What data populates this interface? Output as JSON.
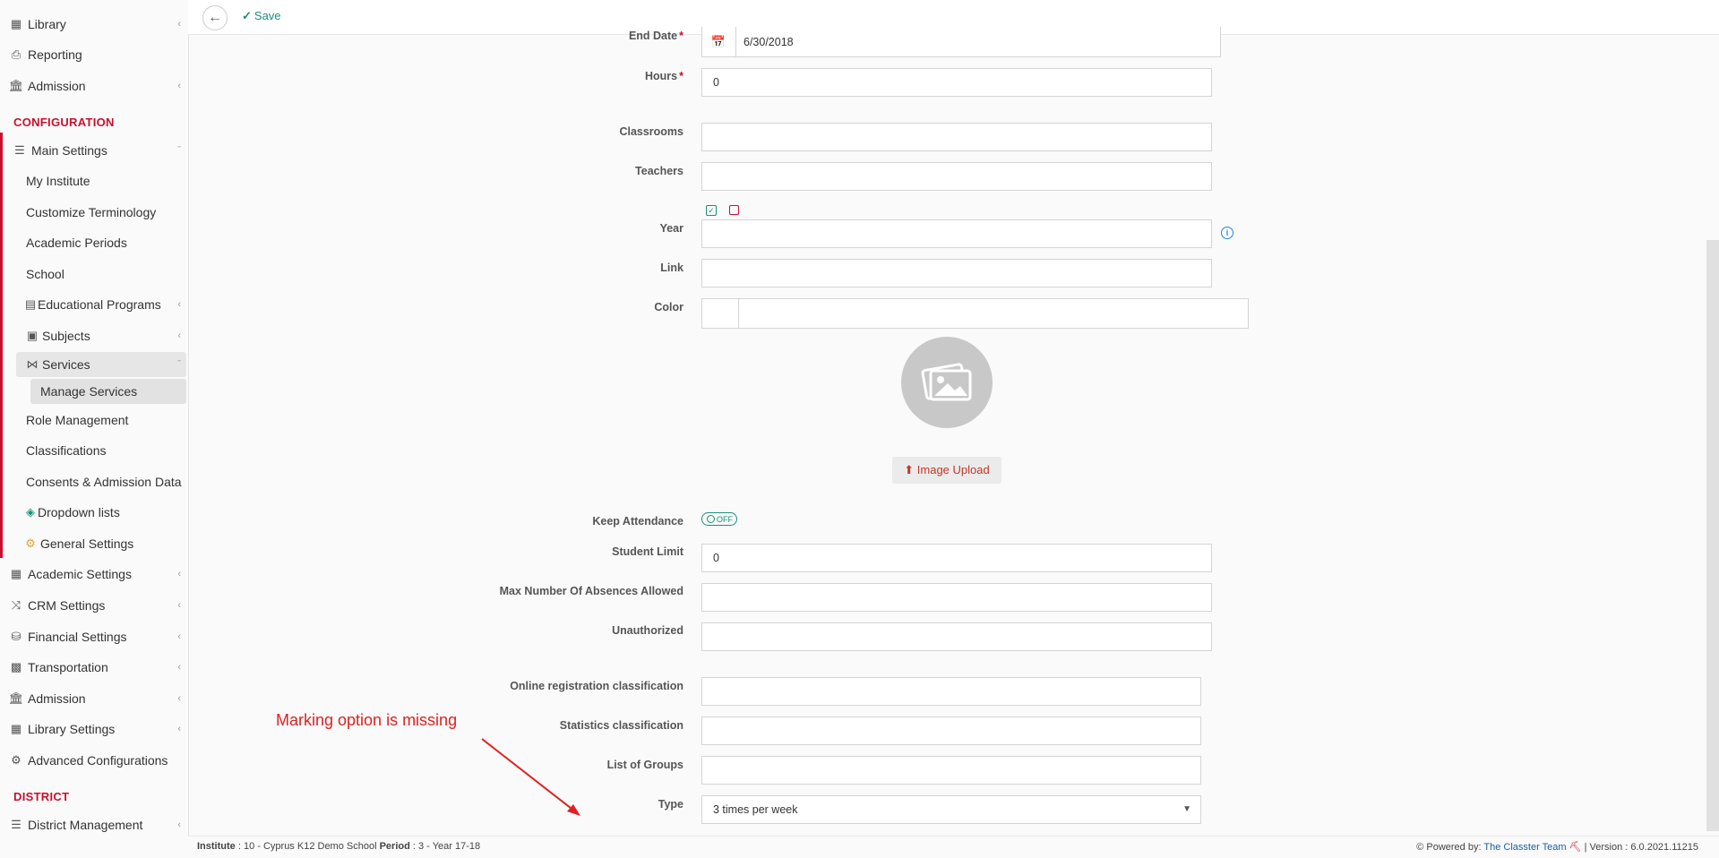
{
  "sidebar": {
    "top_items": [
      {
        "label": "Library",
        "icon": "books-icon",
        "has_children": true
      },
      {
        "label": "Reporting",
        "icon": "printer-icon",
        "has_children": false
      },
      {
        "label": "Admission",
        "icon": "institution-icon",
        "has_children": true
      }
    ],
    "configuration_title": "CONFIGURATION",
    "main_settings": {
      "label": "Main Settings",
      "icon": "sliders-icon"
    },
    "main_settings_items": [
      {
        "label": "My Institute"
      },
      {
        "label": "Customize Terminology"
      },
      {
        "label": "Academic Periods"
      },
      {
        "label": "School"
      },
      {
        "label": "Educational Programs",
        "icon": "table-icon",
        "has_children": true
      },
      {
        "label": "Subjects",
        "icon": "book-icon",
        "has_children": true
      },
      {
        "label": "Services",
        "icon": "network-icon",
        "expanded": true
      },
      {
        "label": "Manage Services",
        "active": true
      },
      {
        "label": "Role Management"
      },
      {
        "label": "Classifications"
      },
      {
        "label": "Consents & Admission Data"
      },
      {
        "label": "Dropdown lists",
        "icon": "layers-icon"
      },
      {
        "label": "General Settings",
        "icon": "gear-icon"
      }
    ],
    "config_items": [
      {
        "label": "Academic Settings",
        "icon": "sitemap-icon",
        "has_children": true
      },
      {
        "label": "CRM Settings",
        "icon": "shuffle-icon",
        "has_children": true
      },
      {
        "label": "Financial Settings",
        "icon": "coins-icon",
        "has_children": true
      },
      {
        "label": "Transportation",
        "icon": "bus-icon",
        "has_children": true
      },
      {
        "label": "Admission",
        "icon": "institution-icon",
        "has_children": true
      },
      {
        "label": "Library Settings",
        "icon": "books-icon",
        "has_children": true
      },
      {
        "label": "Advanced Configurations",
        "icon": "gears-icon",
        "has_children": false
      }
    ],
    "district_title": "DISTRICT",
    "district_items": [
      {
        "label": "District Management",
        "icon": "list-icon",
        "has_children": true
      }
    ]
  },
  "toolbar": {
    "save_label": "Save"
  },
  "form": {
    "end_date": {
      "label": "End Date",
      "value": "6/30/2018"
    },
    "hours": {
      "label": "Hours",
      "value": "0"
    },
    "classrooms": {
      "label": "Classrooms",
      "value": ""
    },
    "teachers": {
      "label": "Teachers",
      "value": ""
    },
    "year": {
      "label": "Year",
      "value": ""
    },
    "link": {
      "label": "Link",
      "value": ""
    },
    "color": {
      "label": "Color",
      "value": ""
    },
    "image_upload_label": "Image Upload",
    "keep_attendance": {
      "label": "Keep Attendance",
      "toggle_text": "OFF"
    },
    "student_limit": {
      "label": "Student Limit",
      "value": "0"
    },
    "max_absences": {
      "label": "Max Number Of Absences Allowed",
      "value": ""
    },
    "unauthorized": {
      "label": "Unauthorized",
      "value": ""
    },
    "online_registration": {
      "label": "Online registration classification",
      "value": ""
    },
    "statistics": {
      "label": "Statistics classification",
      "value": ""
    },
    "list_of_groups": {
      "label": "List of Groups",
      "value": ""
    },
    "type": {
      "label": "Type",
      "value": "3 times per week"
    }
  },
  "annotation": {
    "text": "Marking option is missing",
    "color": "#e02020"
  },
  "footer": {
    "institute_label": "Institute",
    "institute_value": ": 10 - Cyprus K12 Demo School",
    "period_label": "Period",
    "period_value": ": 3 - Year 17-18",
    "powered_by": "Powered by:",
    "team": "The Classter Team",
    "version": "| Version : 6.0.2021.11215"
  },
  "colors": {
    "accent": "#c8102e",
    "save": "#1a8f7a",
    "link": "#1a5fa8"
  }
}
